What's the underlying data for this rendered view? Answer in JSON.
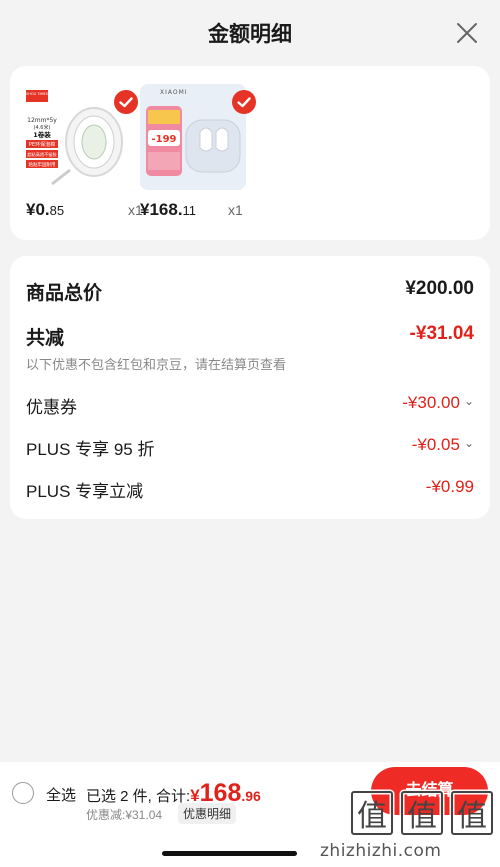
{
  "header": {
    "title": "金额明细",
    "close_icon": "close-icon"
  },
  "products": [
    {
      "name": "tape",
      "image_texts": {
        "brand": "SHOU TIMES",
        "spec": "12mm*5y",
        "spec2": "(4.6米)",
        "pack": "1卷装",
        "tag1": "PE环保泡棉",
        "tag2": "超粘高透不留胶",
        "tag3": "粘贴牢固耐用"
      },
      "price_int": "¥0.",
      "price_dec": "85",
      "qty": "x1",
      "checked": true
    },
    {
      "name": "earbuds",
      "image_texts": {
        "brand": "XIAOMI",
        "promo": "-199"
      },
      "price_int": "¥168.",
      "price_dec": "11",
      "qty": "x1",
      "checked": true
    }
  ],
  "summary": {
    "total_label": "商品总价",
    "total_value": "¥200.00",
    "reduction_label": "共减",
    "reduction_value": "-¥31.04",
    "note": "以下优惠不包含红包和京豆，请在结算页查看",
    "items": [
      {
        "label": "优惠券",
        "value": "-¥30.00",
        "has_chevron": true
      },
      {
        "label": "PLUS 专享 95 折",
        "value": "-¥0.05",
        "has_chevron": true
      },
      {
        "label": "PLUS 专享立减",
        "value": "-¥0.99",
        "has_chevron": false
      }
    ]
  },
  "bottom": {
    "select_all": "全选",
    "selected_prefix": "已选 2 件, 合计:",
    "amount_currency": "¥",
    "amount_int": "168",
    "amount_dec": ".96",
    "discount_text": "优惠减:¥31.04",
    "detail_button": "优惠明细",
    "checkout_button": "去结算"
  },
  "watermark": {
    "glyphs": "值",
    "site": "zhizhizhi.com"
  },
  "colors": {
    "accent": "#e0221a",
    "checkout": "#ef2b26",
    "background": "#f3f3f3"
  }
}
